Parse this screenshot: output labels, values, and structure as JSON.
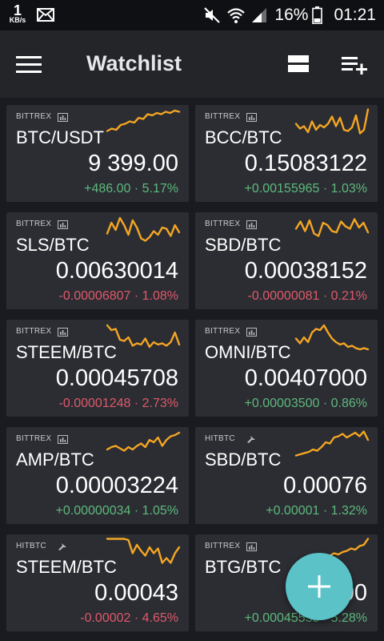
{
  "statusbar": {
    "net_speed": "1",
    "net_unit": "KB/s",
    "battery_pct": "16%",
    "time": "01:21",
    "icons": [
      "mail-icon",
      "mute-icon",
      "wifi-icon",
      "signal-icon",
      "battery-icon"
    ]
  },
  "appbar": {
    "title": "Watchlist",
    "icons": [
      "menu-icon",
      "view-toggle-icon",
      "add-list-icon"
    ]
  },
  "colors": {
    "positive": "#5fb97c",
    "negative": "#e0596a",
    "sparkline": "#f5a623",
    "fab": "#5bc3c7"
  },
  "cards": [
    {
      "exchange": "BITTREX",
      "exchange_icon": "chart-icon",
      "pair": "BTC/USDT",
      "price": "9 399.00",
      "change": "+486.00 · 5.17%",
      "direction": "up",
      "spark": [
        18,
        22,
        20,
        28,
        30,
        34,
        32,
        40,
        38,
        46,
        44,
        48,
        46,
        50,
        48,
        52,
        50
      ]
    },
    {
      "exchange": "BITTREX",
      "exchange_icon": "chart-icon",
      "pair": "BCC/BTC",
      "price": "0.15083122",
      "change": "+0.00155965 · 1.03%",
      "direction": "up",
      "spark": [
        30,
        22,
        26,
        16,
        34,
        20,
        28,
        24,
        30,
        42,
        26,
        40,
        20,
        18,
        24,
        44,
        14,
        20,
        54
      ]
    },
    {
      "exchange": "BITTREX",
      "exchange_icon": "chart-icon",
      "pair": "SLS/BTC",
      "price": "0.00630014",
      "change": "-0.00006807 · 1.08%",
      "direction": "down",
      "spark": [
        26,
        44,
        32,
        52,
        40,
        24,
        48,
        36,
        18,
        14,
        20,
        30,
        24,
        36,
        34,
        22,
        40,
        28
      ]
    },
    {
      "exchange": "BITTREX",
      "exchange_icon": "chart-icon",
      "pair": "SBD/BTC",
      "price": "0.00038152",
      "change": "-0.00000081 · 0.21%",
      "direction": "down",
      "spark": [
        34,
        46,
        30,
        48,
        26,
        22,
        44,
        40,
        30,
        28,
        46,
        38,
        34,
        50,
        36,
        44,
        28
      ]
    },
    {
      "exchange": "BITTREX",
      "exchange_icon": "chart-icon",
      "pair": "STEEM/BTC",
      "price": "0.00045708",
      "change": "-0.00001248 · 2.73%",
      "direction": "down",
      "spark": [
        52,
        44,
        46,
        28,
        26,
        32,
        18,
        22,
        20,
        30,
        16,
        24,
        20,
        22,
        18,
        24,
        40,
        20
      ]
    },
    {
      "exchange": "BITTREX",
      "exchange_icon": "chart-icon",
      "pair": "OMNI/BTC",
      "price": "0.00407000",
      "change": "+0.00003500 · 0.86%",
      "direction": "up",
      "spark": [
        30,
        22,
        32,
        24,
        40,
        46,
        44,
        52,
        40,
        30,
        24,
        20,
        22,
        16,
        18,
        14,
        12,
        14,
        12
      ]
    },
    {
      "exchange": "BITTREX",
      "exchange_icon": "chart-icon",
      "pair": "AMP/BTC",
      "price": "0.00003224",
      "change": "+0.00000034 · 1.05%",
      "direction": "up",
      "spark": [
        24,
        28,
        30,
        26,
        22,
        28,
        24,
        30,
        34,
        28,
        40,
        36,
        44,
        30,
        40,
        46,
        48,
        52
      ]
    },
    {
      "exchange": "HITBTC",
      "exchange_icon": "bird-icon",
      "pair": "SBD/BTC",
      "price": "0.00076",
      "change": "+0.00001 · 1.32%",
      "direction": "up",
      "spark": [
        14,
        16,
        18,
        20,
        24,
        22,
        28,
        36,
        34,
        44,
        46,
        50,
        44,
        48,
        52,
        46,
        54,
        40
      ]
    },
    {
      "exchange": "HITBTC",
      "exchange_icon": "bird-icon",
      "pair": "STEEM/BTC",
      "price": "0.00043",
      "change": "-0.00002 · 4.65%",
      "direction": "down",
      "spark": [
        54,
        54,
        54,
        54,
        54,
        52,
        30,
        44,
        34,
        26,
        40,
        30,
        38,
        14,
        22,
        14,
        30,
        40
      ]
    },
    {
      "exchange": "BITTREX",
      "exchange_icon": "chart-icon",
      "pair": "BTG/BTC",
      "price": "0.00",
      "change": "+0.00045535 · 5.28%",
      "direction": "up",
      "spark": [
        10,
        12,
        14,
        16,
        18,
        20,
        22,
        24,
        26,
        30,
        28,
        32,
        34,
        38,
        36,
        42,
        44,
        54
      ]
    }
  ],
  "fab": {
    "icon": "plus-icon"
  }
}
